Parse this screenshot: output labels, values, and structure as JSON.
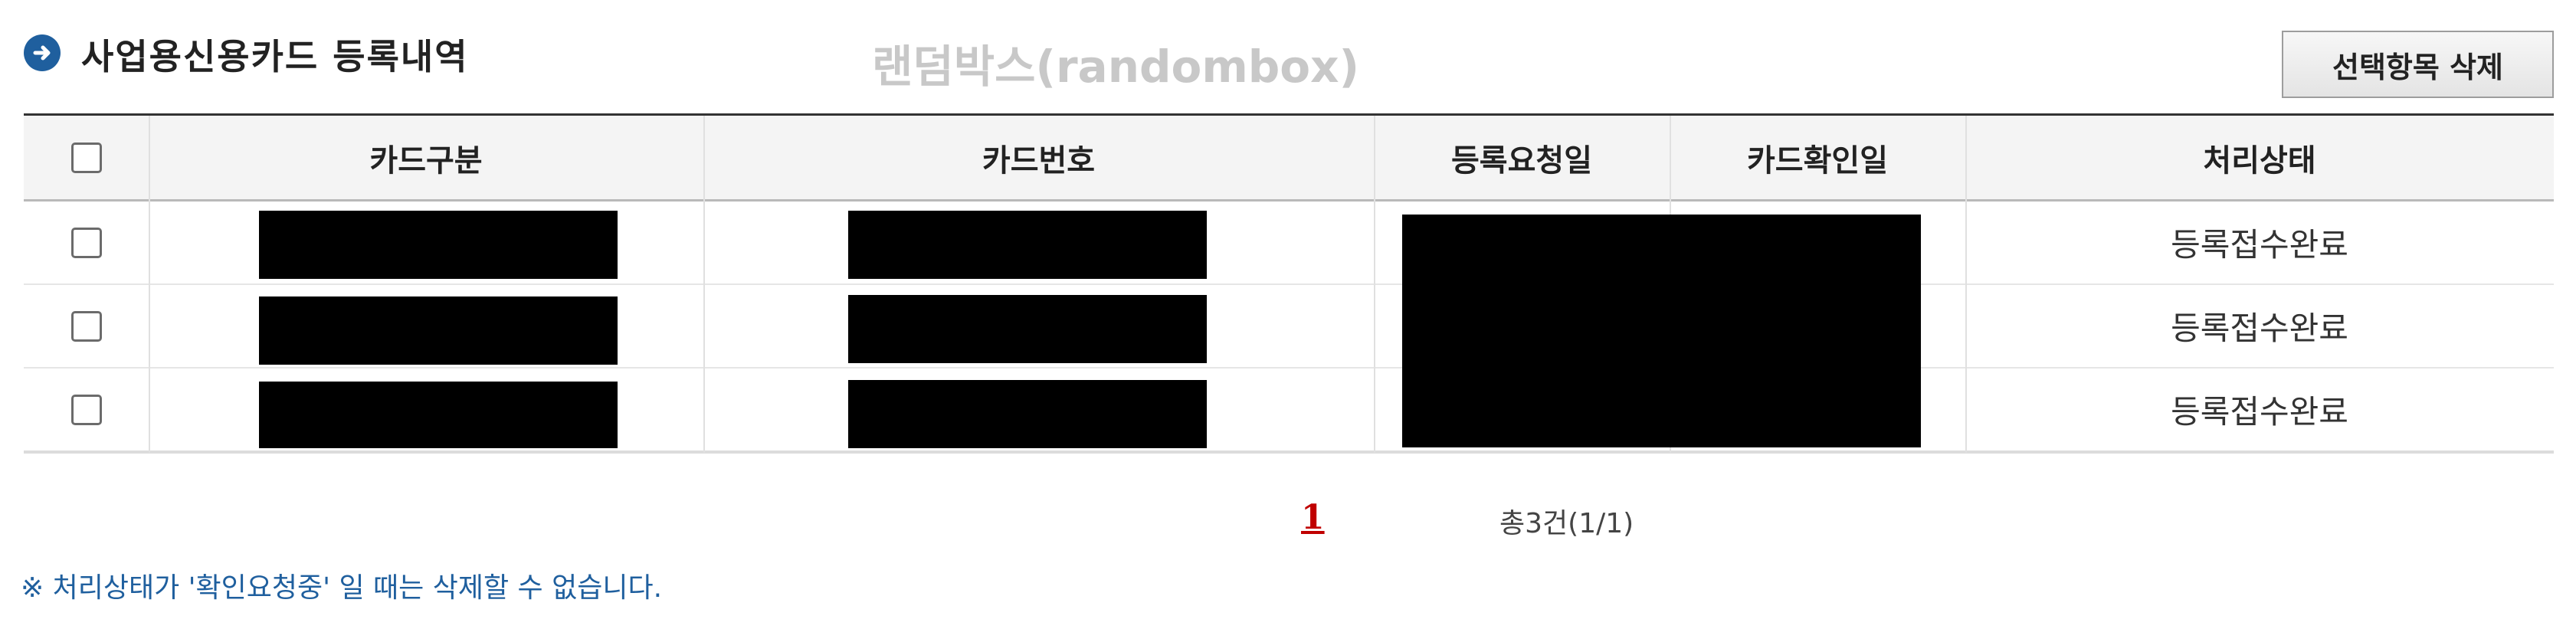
{
  "title": "사업용신용카드 등록내역",
  "watermark": "랜덤박스(randombox)",
  "delete_button": "선택항목 삭제",
  "columns": [
    "카드구분",
    "카드번호",
    "등록요청일",
    "카드확인일",
    "처리상태"
  ],
  "rows": [
    {
      "status": "등록접수완료"
    },
    {
      "status": "등록접수완료"
    },
    {
      "status": "등록접수완료"
    }
  ],
  "pagination": {
    "current_page": "1",
    "total_text": "총3건(1/1)"
  },
  "note": "※ 처리상태가 '확인요청중' 일 때는 삭제할 수 없습니다.",
  "colors": {
    "accent": "#1f5f9e",
    "page_active": "#c00000",
    "header_bg": "#f4f4f4"
  }
}
